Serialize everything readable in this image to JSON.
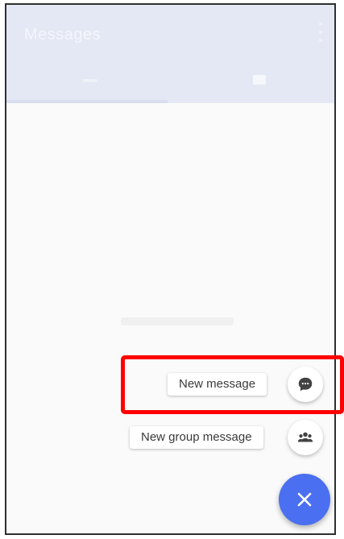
{
  "speed_dial": {
    "new_message_label": "New message",
    "new_group_message_label": "New group message"
  },
  "icons": {
    "new_message": "chat-bubble-icon",
    "new_group_message": "group-icon",
    "close": "close-icon"
  },
  "colors": {
    "fab": "#4a6ff0",
    "highlight": "#ff0000",
    "app_bar": "#e3e8f4"
  }
}
